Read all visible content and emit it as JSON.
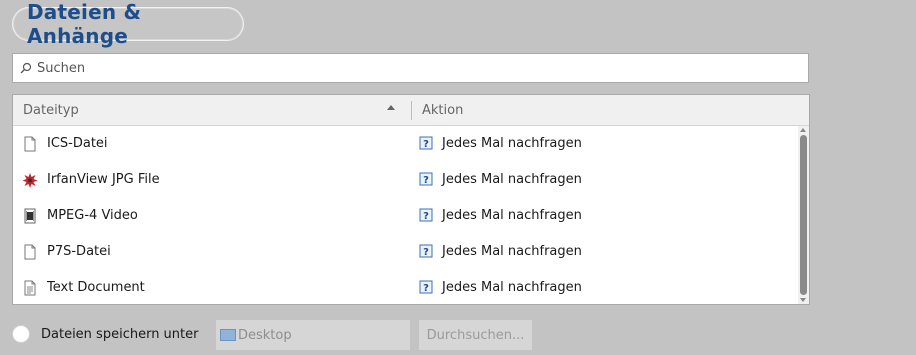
{
  "header": {
    "title": "Dateien & Anhänge"
  },
  "search": {
    "placeholder": "Suchen"
  },
  "table": {
    "columns": {
      "type": "Dateityp",
      "action": "Aktion"
    },
    "rows": [
      {
        "type": "ICS-Datei",
        "icon": "blank-file-icon",
        "action": "Jedes Mal nachfragen"
      },
      {
        "type": "IrfanView JPG File",
        "icon": "irfanview-icon",
        "action": "Jedes Mal nachfragen"
      },
      {
        "type": "MPEG-4 Video",
        "icon": "video-file-icon",
        "action": "Jedes Mal nachfragen"
      },
      {
        "type": "P7S-Datei",
        "icon": "blank-file-icon",
        "action": "Jedes Mal nachfragen"
      },
      {
        "type": "Text Document",
        "icon": "text-file-icon",
        "action": "Jedes Mal nachfragen"
      }
    ]
  },
  "save": {
    "label": "Dateien speichern unter",
    "path": "Desktop",
    "browse_label": "Durchsuchen..."
  },
  "colors": {
    "title": "#1d4e8c",
    "background": "#c3c3c3"
  }
}
